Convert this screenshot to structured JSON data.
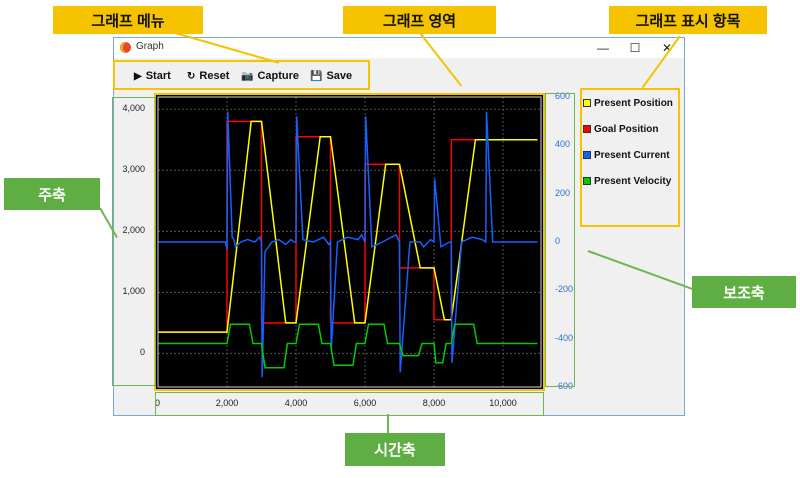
{
  "window": {
    "title": "Graph",
    "minimize_glyph": "—",
    "maximize_glyph": "☐",
    "close_glyph": "✕"
  },
  "toolbar": {
    "start_label": "Start",
    "reset_label": "Reset",
    "capture_label": "Capture",
    "save_label": "Save",
    "start_icon": "▶",
    "reset_icon": "↻",
    "capture_icon": "📷",
    "save_icon": "💾"
  },
  "legend": {
    "items": [
      {
        "label": "Present Position",
        "color": "#ffff00"
      },
      {
        "label": "Goal Position",
        "color": "#ff0000"
      },
      {
        "label": "Present Current",
        "color": "#1560ff"
      },
      {
        "label": "Present Velocity",
        "color": "#00cc00"
      }
    ]
  },
  "callouts": {
    "graph_menu": "그래프 메뉴",
    "graph_area": "그래프 영역",
    "graph_legend": "그래프 표시 항목",
    "primary_axis": "주축",
    "secondary_axis": "보조축",
    "time_axis": "시간축"
  },
  "chart_data": {
    "type": "line",
    "x_ticks": [
      "0",
      "2,000",
      "4,000",
      "6,000",
      "8,000",
      "10,000"
    ],
    "y_ticks": [
      "0",
      "1,000",
      "2,000",
      "3,000",
      "4,000"
    ],
    "y2_ticks": [
      "600",
      "400",
      "200",
      "0",
      "-200",
      "-400",
      "-600"
    ],
    "xlim": [
      0,
      11100
    ],
    "ylim": [
      -550,
      4200
    ],
    "y2lim": [
      -600,
      600
    ],
    "background": "#000000",
    "grid": true,
    "series": [
      {
        "name": "Goal Position",
        "axis": "primary",
        "color": "#ff0000",
        "x": [
          0,
          2000,
          2000,
          3000,
          3000,
          4000,
          4000,
          5000,
          5000,
          6000,
          6000,
          7000,
          7000,
          8000,
          8000,
          8500,
          8500,
          9500,
          9500,
          11000
        ],
        "y": [
          350,
          350,
          3800,
          3800,
          500,
          500,
          3550,
          3550,
          500,
          500,
          3100,
          3100,
          1400,
          1400,
          550,
          550,
          3500,
          3500,
          3500,
          3500
        ]
      },
      {
        "name": "Present Position",
        "axis": "primary",
        "color": "#ffff00",
        "x": [
          0,
          2000,
          2700,
          3000,
          3700,
          4000,
          4700,
          5000,
          5700,
          6000,
          6600,
          7000,
          7600,
          8000,
          8300,
          8500,
          9200,
          9500,
          11000
        ],
        "y": [
          350,
          350,
          3800,
          3800,
          500,
          500,
          3550,
          3550,
          500,
          500,
          3100,
          3100,
          1400,
          1400,
          550,
          550,
          3500,
          3500,
          3500
        ]
      },
      {
        "name": "Present Current",
        "axis": "secondary",
        "color": "#1560ff",
        "x": [
          0,
          1950,
          2000,
          2020,
          2150,
          2200,
          2250,
          2400,
          2600,
          2800,
          2950,
          3000,
          3020,
          3100,
          3300,
          3500,
          3700,
          3850,
          3950,
          4000,
          4020,
          4200,
          4500,
          4800,
          4950,
          5000,
          5020,
          5200,
          5500,
          5800,
          5900,
          6000,
          6020,
          6200,
          6500,
          6900,
          7000,
          7020,
          7300,
          7600,
          7700,
          7900,
          8000,
          8020,
          8200,
          8450,
          8500,
          8520,
          8800,
          9100,
          9400,
          9500,
          9520,
          9700,
          11000
        ],
        "y": [
          0,
          0,
          -30,
          540,
          20,
          10,
          -20,
          0,
          10,
          0,
          20,
          0,
          -560,
          -40,
          0,
          10,
          -10,
          10,
          0,
          0,
          520,
          10,
          0,
          20,
          -10,
          0,
          -450,
          0,
          20,
          10,
          30,
          0,
          520,
          -20,
          0,
          30,
          0,
          -540,
          0,
          0,
          -20,
          10,
          0,
          260,
          -20,
          0,
          0,
          -500,
          0,
          20,
          10,
          0,
          540,
          0,
          0
        ]
      },
      {
        "name": "Present Velocity",
        "axis": "secondary",
        "color": "#00cc00",
        "x": [
          0,
          2000,
          2100,
          2650,
          2750,
          3000,
          3100,
          3650,
          3750,
          4000,
          4100,
          4650,
          4750,
          5000,
          5100,
          5650,
          5750,
          6000,
          6100,
          6550,
          6650,
          7000,
          7100,
          7550,
          7650,
          8000,
          8050,
          8250,
          8350,
          8500,
          8600,
          9150,
          9250,
          11000
        ],
        "y": [
          -420,
          -420,
          -340,
          -340,
          -420,
          -420,
          -520,
          -520,
          -420,
          -420,
          -340,
          -340,
          -420,
          -420,
          -510,
          -510,
          -420,
          -420,
          -340,
          -340,
          -420,
          -420,
          -470,
          -470,
          -420,
          -420,
          -500,
          -500,
          -420,
          -420,
          -340,
          -340,
          -420,
          -420
        ]
      }
    ]
  }
}
